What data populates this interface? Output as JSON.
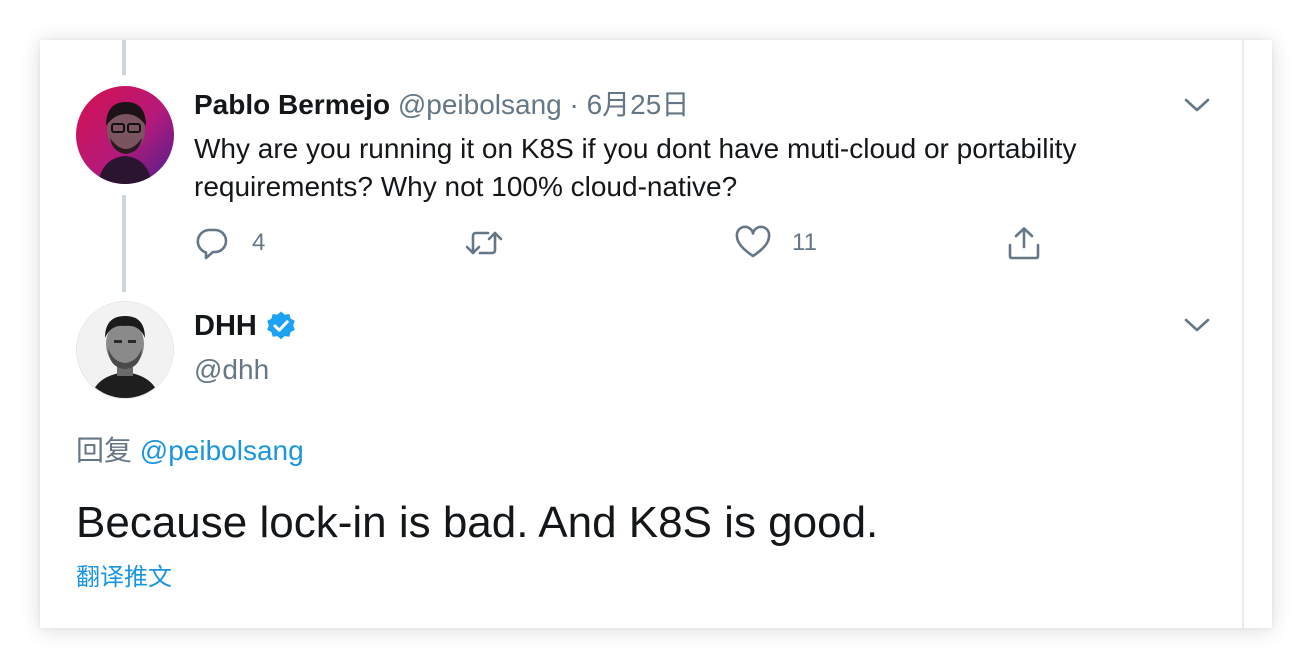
{
  "previous_tweet": {
    "author": {
      "name": "Pablo Bermejo",
      "handle": "@peibolsang",
      "separator": "·",
      "date": "6月25日"
    },
    "text": "Why are you running it on K8S if you dont have muti-cloud or portability requirements? Why not 100% cloud-native?",
    "actions": {
      "reply_count": "4",
      "retweet_count": "",
      "like_count": "11"
    }
  },
  "main_tweet": {
    "author": {
      "name": "DHH",
      "handle": "@dhh",
      "verified": true
    },
    "reply_prefix": "回复",
    "reply_mention": "@peibolsang",
    "text": "Because lock-in is bad. And K8S is good.",
    "translate_label": "翻译推文"
  },
  "colors": {
    "link": "#1b95e0",
    "secondary_text": "#657786",
    "verified_badge": "#1da1f2",
    "thread_line": "#ccd6dd"
  },
  "icons": [
    "reply-icon",
    "retweet-icon",
    "like-icon",
    "share-icon",
    "chevron-down-icon",
    "verified-badge-icon"
  ]
}
